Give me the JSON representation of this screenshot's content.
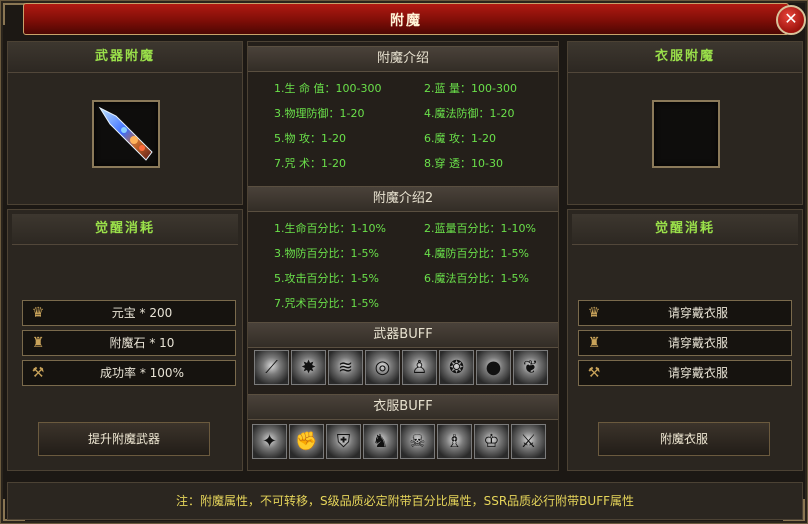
{
  "window": {
    "title": "附魔",
    "close_icon": "close-icon"
  },
  "left": {
    "header": "武器附魔",
    "item_icon": "weapon-sword-icon",
    "consume_header": "觉醒消耗",
    "costs": [
      {
        "icon": "gold-ingot-icon",
        "text": "元宝 * 200"
      },
      {
        "icon": "enchant-stone-icon",
        "text": "附魔石 * 10"
      },
      {
        "icon": "anvil-icon",
        "text": "成功率 * 100%"
      }
    ],
    "button": "提升附魔武器"
  },
  "center": {
    "intro1": {
      "title": "附魔介绍",
      "stats": [
        "1.生 命 值：100-300",
        "2.蓝    量：100-300",
        "3.物理防御：1-20",
        "4.魔法防御：1-20",
        "5.物    攻：1-20",
        "6.魔    攻：1-20",
        "7.咒    术：1-20",
        "8.穿    透：10-30"
      ]
    },
    "intro2": {
      "title": "附魔介绍2",
      "stats": [
        "1.生命百分比：1-10%",
        "2.蓝量百分比：1-10%",
        "3.物防百分比：1-5%",
        "4.魔防百分比：1-5%",
        "5.攻击百分比：1-5%",
        "6.魔法百分比：1-5%",
        "7.咒术百分比：1-5%"
      ]
    },
    "weapon_buff": {
      "title": "武器BUFF",
      "icons": [
        "slash-icon",
        "burst-icon",
        "whirlwind-icon",
        "vortex-icon",
        "spirit-figure-icon",
        "tornado-icon",
        "orb-icon",
        "flame-wing-icon"
      ]
    },
    "cloth_buff": {
      "title": "衣服BUFF",
      "icons": [
        "shield-break-icon",
        "fist-icon",
        "shield-icon",
        "warrior-icon",
        "demon-mask-icon",
        "aura-figure-icon",
        "energy-figure-icon",
        "blade-icon",
        "chain-icon"
      ]
    }
  },
  "right": {
    "header": "衣服附魔",
    "consume_header": "觉醒消耗",
    "costs": [
      {
        "icon": "gold-ingot-icon",
        "text": "请穿戴衣服"
      },
      {
        "icon": "enchant-stone-icon",
        "text": "请穿戴衣服"
      },
      {
        "icon": "anvil-icon",
        "text": "请穿戴衣服"
      }
    ],
    "button": "附魔衣服"
  },
  "note": "注：附魔属性，不可转移，S级品质必定附带百分比属性，SSR品质必行附带BUFF属性"
}
